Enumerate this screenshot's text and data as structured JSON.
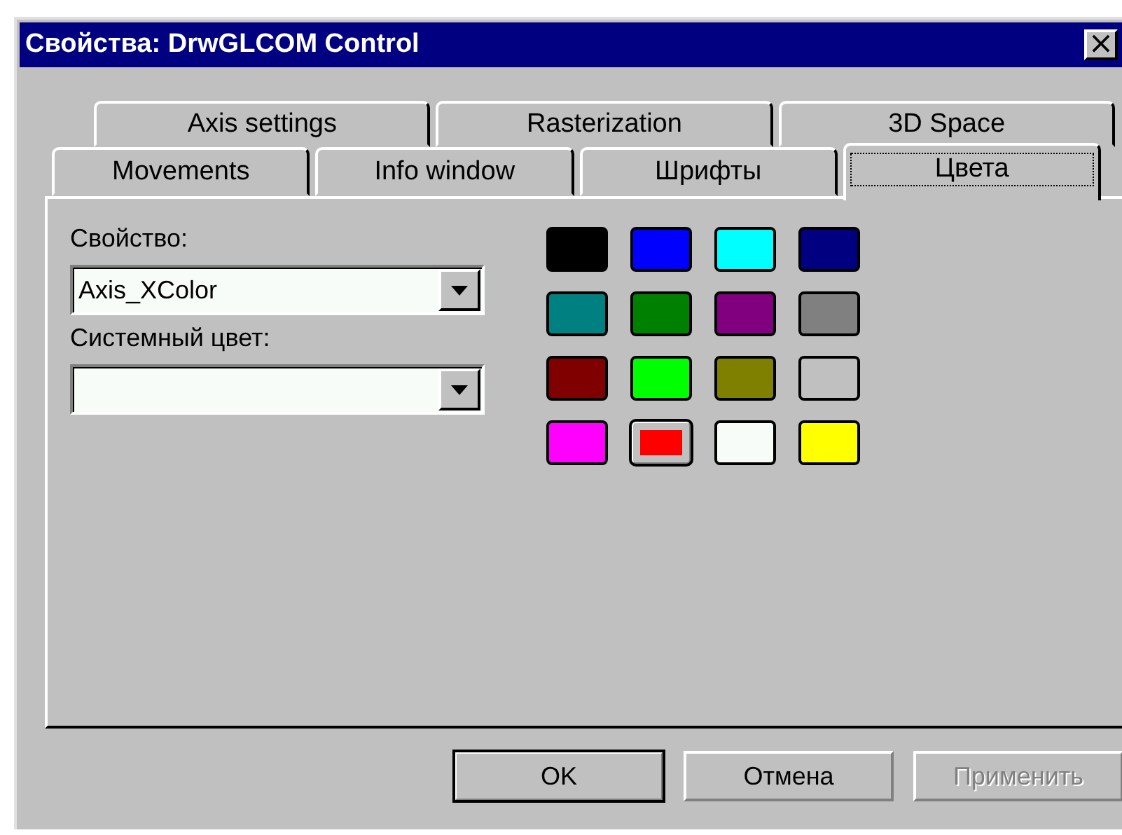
{
  "window": {
    "title": "Свойства: DrwGLCOM Control",
    "close": "×"
  },
  "tab_rows": [
    {
      "tabs": [
        {
          "label": "Axis settings",
          "selected": false
        },
        {
          "label": "Rasterization",
          "selected": false
        },
        {
          "label": "3D Space",
          "selected": false
        }
      ]
    },
    {
      "tabs": [
        {
          "label": "Movements",
          "selected": false
        },
        {
          "label": "Info window",
          "selected": false
        },
        {
          "label": "Шрифты",
          "selected": false
        },
        {
          "label": "Цвета",
          "selected": true
        }
      ]
    }
  ],
  "fields": [
    {
      "label": "Свойство:",
      "value": "Axis_XColor"
    },
    {
      "label": "Системный цвет:"
    }
  ],
  "swatches": [
    {
      "color": "#000000",
      "selected": false
    },
    {
      "color": "#0000ff",
      "selected": false
    },
    {
      "color": "#00ffff",
      "selected": false
    },
    {
      "color": "#000080",
      "selected": false
    },
    {
      "color": "#008080",
      "selected": false
    },
    {
      "color": "#008000",
      "selected": false
    },
    {
      "color": "#800080",
      "selected": false
    },
    {
      "color": "#808080",
      "selected": false
    },
    {
      "color": "#800000",
      "selected": false
    },
    {
      "color": "#00ff00",
      "selected": false
    },
    {
      "color": "#808000",
      "selected": false
    },
    {
      "color": "#c0c0c0",
      "selected": false
    },
    {
      "color": "#ff00ff",
      "selected": false
    },
    {
      "color": "#ff0000",
      "selected": true
    },
    {
      "color": "#f8fcf8",
      "selected": false
    },
    {
      "color": "#ffff00",
      "selected": false
    }
  ],
  "buttons": [
    {
      "label": "OK",
      "disabled": false,
      "default": true
    },
    {
      "label": "Отмена",
      "disabled": false,
      "default": false
    },
    {
      "label": "Применить",
      "disabled": true,
      "default": false
    }
  ]
}
